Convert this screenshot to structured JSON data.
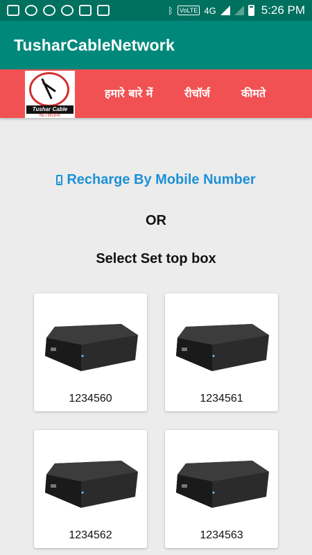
{
  "status_bar": {
    "network": "4G",
    "volte": "VoLTE",
    "time": "5:26 PM",
    "icons": [
      "messages-icon",
      "whatsapp-icon",
      "messenger-icon",
      "chrome-icon",
      "screenshot-icon",
      "gallery-icon",
      "bluetooth-icon",
      "signal-icon",
      "battery-icon"
    ]
  },
  "app_bar": {
    "title": "TusharCableNetwork"
  },
  "nav": {
    "logo_text": "Tushar Cable",
    "logo_sub": "NETWORK",
    "items": [
      {
        "label": "हमारे बारे में"
      },
      {
        "label": "रीचॉर्ज"
      },
      {
        "label": "कीमते"
      }
    ]
  },
  "main": {
    "recharge_link": "Recharge By Mobile Number",
    "or_text": "OR",
    "select_heading": "Select Set top box"
  },
  "set_top_boxes": [
    {
      "id": "1234560"
    },
    {
      "id": "1234561"
    },
    {
      "id": "1234562"
    },
    {
      "id": "1234563"
    }
  ],
  "colors": {
    "status_bar": "#00705f",
    "app_bar": "#00897b",
    "nav_bar": "#f15152",
    "link": "#1e90d6",
    "background": "#ececec"
  }
}
